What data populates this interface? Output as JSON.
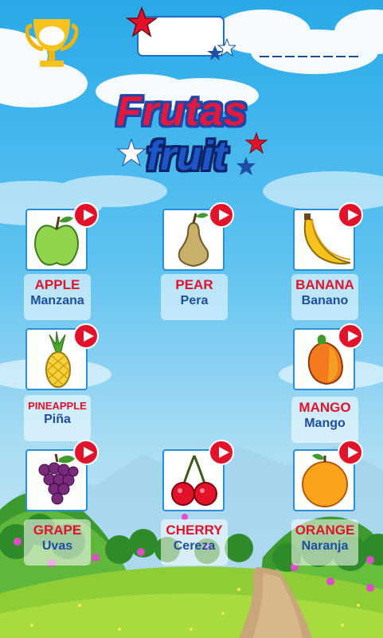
{
  "header": {
    "word_blanks": 8
  },
  "logo": {
    "title_es": "Frutas",
    "title_en": "fruit"
  },
  "fruits": [
    {
      "en": "APPLE",
      "es": "Manzana",
      "icon": "apple-icon"
    },
    {
      "en": "PEAR",
      "es": "Pera",
      "icon": "pear-icon"
    },
    {
      "en": "BANANA",
      "es": "Banano",
      "icon": "banana-icon"
    },
    {
      "en": "PINEAPPLE",
      "es": "Piña",
      "icon": "pineapple-icon"
    },
    {
      "en": "MANGO",
      "es": "Mango",
      "icon": "mango-icon"
    },
    {
      "en": "GRAPE",
      "es": "Uvas",
      "icon": "grape-icon"
    },
    {
      "en": "CHERRY",
      "es": "Cereza",
      "icon": "cherry-icon"
    },
    {
      "en": "ORANGE",
      "es": "Naranja",
      "icon": "orange-icon"
    }
  ],
  "colors": {
    "label_en": "#e3122b",
    "label_es": "#1c4fa3",
    "play_button": "#e3122b",
    "card_border": "#2a8fd6"
  }
}
